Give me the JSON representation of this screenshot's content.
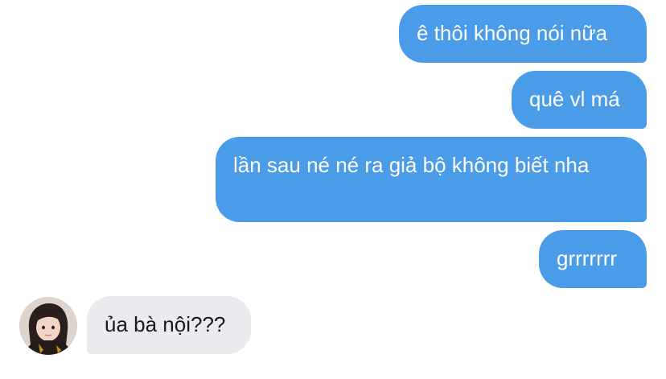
{
  "conversation": {
    "messages": [
      {
        "direction": "outgoing",
        "text": "ê thôi không nói nữa"
      },
      {
        "direction": "outgoing",
        "text": "quê vl má"
      },
      {
        "direction": "outgoing",
        "text": "lần sau né né ra giả bộ không biết nha"
      },
      {
        "direction": "outgoing",
        "text": "grrrrrrr"
      },
      {
        "direction": "incoming",
        "text": "ủa bà nội???"
      }
    ]
  },
  "colors": {
    "outgoing_bubble": "#4a9be8",
    "incoming_bubble": "#e9ebee",
    "background": "#ffffff"
  },
  "icons": {
    "sender_avatar": "avatar-photo"
  }
}
